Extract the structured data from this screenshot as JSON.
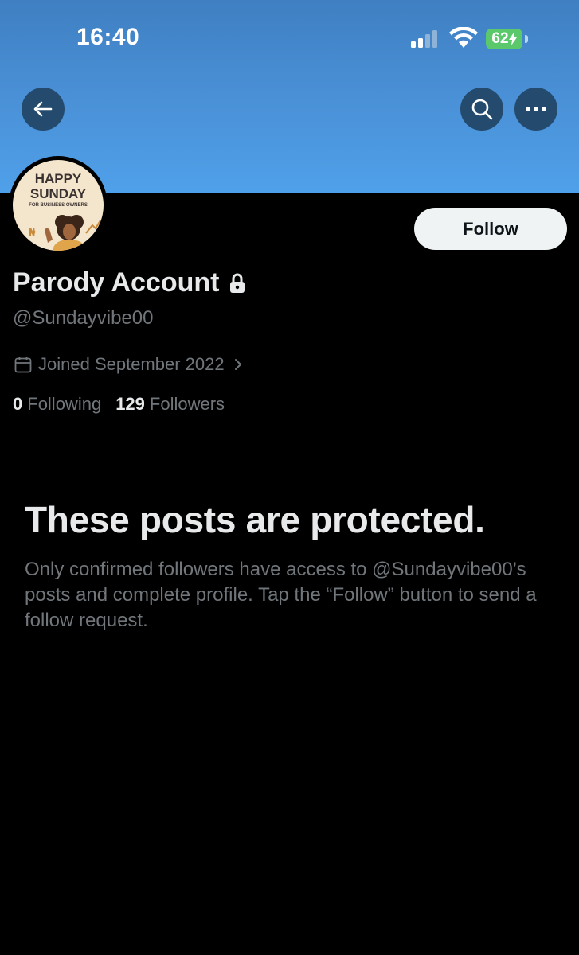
{
  "status_bar": {
    "time": "16:40",
    "battery": "62",
    "icons": [
      "signal-icon",
      "wifi-icon",
      "battery-charging-icon"
    ]
  },
  "header": {
    "banner_color": "#4a90d6",
    "icons": [
      "back-arrow-icon",
      "search-icon",
      "more-icon"
    ]
  },
  "avatar": {
    "title_line1": "HAPPY",
    "title_line2": "SUNDAY",
    "subtitle": "FOR BUSINESS OWNERS"
  },
  "profile": {
    "follow_label": "Follow",
    "display_name": "Parody Account",
    "handle": "@Sundayvibe00",
    "joined": "Joined September 2022",
    "following_count": "0",
    "following_label": "Following",
    "followers_count": "129",
    "followers_label": "Followers"
  },
  "protected": {
    "title": "These posts are protected.",
    "description": "Only confirmed followers have access to @Sundayvibe00’s posts and complete profile. Tap the “Follow” button to send a follow request."
  },
  "colors": {
    "background": "#000000",
    "text_primary": "#e7e9ea",
    "text_secondary": "#71767b",
    "button_bg": "#eff3f4",
    "header_button_bg": "#244a6d",
    "battery_green": "#5ac86b"
  }
}
